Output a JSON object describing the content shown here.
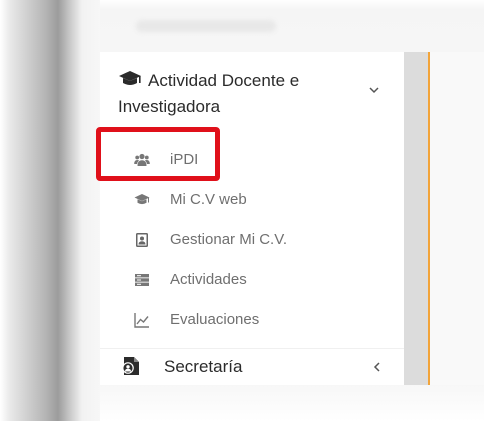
{
  "sidebar": {
    "section_title": "Actividad Docente e Investigadora",
    "section_icon": "graduation-cap-icon",
    "items": [
      {
        "label": "iPDI",
        "icon": "users-icon"
      },
      {
        "label": "Mi C.V web",
        "icon": "graduation-cap-icon"
      },
      {
        "label": "Gestionar Mi C.V.",
        "icon": "address-card-icon"
      },
      {
        "label": "Actividades",
        "icon": "list-icon"
      },
      {
        "label": "Evaluaciones",
        "icon": "line-chart-icon"
      }
    ],
    "section2_title": "Secretaría",
    "section2_icon": "file-user-icon"
  },
  "colors": {
    "highlight": "#e0101a",
    "accent_line": "#f2a43a",
    "text_dark": "#2b2b2b",
    "text_muted": "#6f6f6f"
  }
}
